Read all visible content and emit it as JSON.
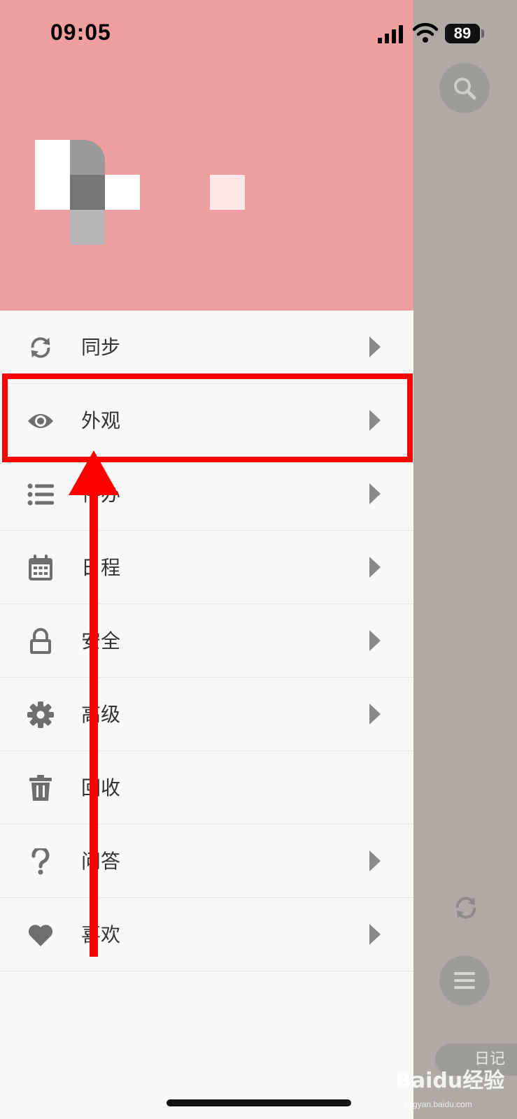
{
  "status_bar": {
    "time": "09:05",
    "battery": "89"
  },
  "menu": {
    "items": [
      {
        "label": "同步",
        "icon": "sync-icon",
        "chevron": true
      },
      {
        "label": "外观",
        "icon": "eye-icon",
        "chevron": true
      },
      {
        "label": "待办",
        "icon": "list-icon",
        "chevron": true
      },
      {
        "label": "日程",
        "icon": "calendar-icon",
        "chevron": true
      },
      {
        "label": "安全",
        "icon": "lock-icon",
        "chevron": true
      },
      {
        "label": "高级",
        "icon": "gear-icon",
        "chevron": true
      },
      {
        "label": "回收",
        "icon": "trash-icon",
        "chevron": false
      },
      {
        "label": "问答",
        "icon": "question-icon",
        "chevron": true
      },
      {
        "label": "喜欢",
        "icon": "heart-icon",
        "chevron": true
      }
    ]
  },
  "sidebar_overlay": {
    "diary_tab": "日记"
  },
  "watermark": {
    "brand": "Baidu经验",
    "url": "jingyan.baidu.com"
  },
  "colors": {
    "header_bg": "#ef9f9f",
    "drawer_bg": "#f9f8f6",
    "overlay_bg": "#adaba4",
    "highlight": "#ff0000",
    "icon_gray": "#6e6e6e"
  }
}
